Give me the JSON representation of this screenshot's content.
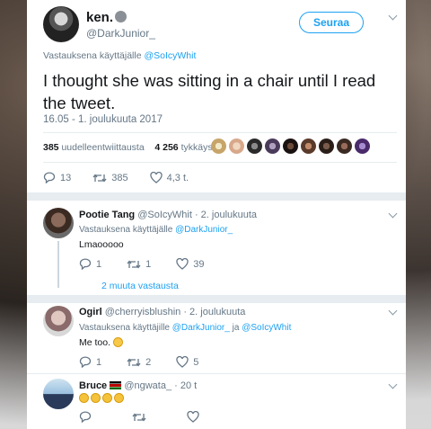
{
  "main_tweet": {
    "user_name": "ken.",
    "handle": "@DarkJunior_",
    "follow_label": "Seuraa",
    "reply_prefix": "Vastauksena käyttäjälle",
    "reply_to": "@SoIcyWhit",
    "text": "I thought she was sitting in a chair until I read the tweet.",
    "time": "16.05 - 1. joulukuuta 2017",
    "retweets_count": "385",
    "retweets_label": "uudelleentwiittausta",
    "likes_count": "4 256",
    "likes_label": "tykkäystä",
    "actions": {
      "reply": "13",
      "retweet": "385",
      "like": "4,3 t."
    }
  },
  "replies": [
    {
      "name": "Pootie Tang",
      "handle": "@SoIcyWhit",
      "time": "· 2. joulukuuta",
      "reply_prefix": "Vastauksena käyttäjälle",
      "reply_to": "@DarkJunior_",
      "reply_and": "",
      "reply_to_2": "",
      "text": "Lmaooooo",
      "actions": {
        "reply": "1",
        "retweet": "1",
        "like": "39"
      },
      "more": "2 muuta vastausta"
    },
    {
      "name": "Ogirl",
      "handle": "@cherryisblushin",
      "time": "· 2. joulukuuta",
      "reply_prefix": "Vastauksena käyttäjille",
      "reply_to": "@DarkJunior_",
      "reply_and": "ja",
      "reply_to_2": "@SoIcyWhit",
      "text": "Me too.",
      "actions": {
        "reply": "1",
        "retweet": "2",
        "like": "5"
      }
    },
    {
      "name": "Bruce",
      "handle": "@ngwata_",
      "time": "· 20 t",
      "actions": {
        "reply": "",
        "retweet": "",
        "like": ""
      }
    }
  ],
  "colors": {
    "accent": "#1da1f2",
    "muted": "#657786",
    "divider": "#e6ecf0"
  }
}
